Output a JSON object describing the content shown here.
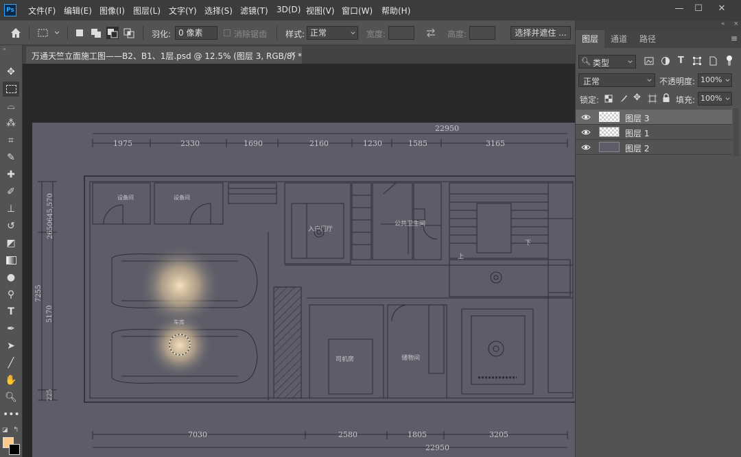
{
  "app": {
    "logo": "Ps",
    "menu": [
      "文件(F)",
      "编辑(E)",
      "图像(I)",
      "图层(L)",
      "文字(Y)",
      "选择(S)",
      "滤镜(T)",
      "3D(D)",
      "视图(V)",
      "窗口(W)",
      "帮助(H)"
    ],
    "window_controls": {
      "minimize": "—",
      "maximize": "☐",
      "close": "✕"
    }
  },
  "options": {
    "feather_label": "羽化:",
    "feather_value": "0 像素",
    "antialias_label": "消除锯齿",
    "style_label": "样式:",
    "style_value": "正常",
    "width_label": "宽度:",
    "height_label": "高度:",
    "select_mask_button": "选择并遮住 ..."
  },
  "document": {
    "tab_title": "万通天竺立面施工图——B2、B1、1层.psd @ 12.5% (图层 3, RGB/8) *",
    "close": "×"
  },
  "drawing": {
    "top_total": "22950",
    "top_dims": [
      "1975",
      "2330",
      "1690",
      "2160",
      "1230",
      "1585",
      "3165"
    ],
    "bottom_dims": [
      "7030",
      "2580",
      "1805",
      "3205"
    ],
    "bottom_total": "22950",
    "left_top": "2650645,570",
    "left_total": "7255",
    "left_mid": "5170",
    "left_bottom": "225",
    "rooms": [
      "设备间",
      "设备间",
      "入户门厅",
      "公共卫生间",
      "车库",
      "司机房",
      "储物间",
      "上",
      "下"
    ]
  },
  "panel": {
    "tabs": [
      "图层",
      "通道",
      "路径"
    ],
    "filter_kind": "类型",
    "blend_mode": "正常",
    "opacity_label": "不透明度:",
    "opacity_value": "100%",
    "lock_label": "锁定:",
    "fill_label": "填充:",
    "fill_value": "100%",
    "layers": [
      {
        "name": "图层 3",
        "selected": true
      },
      {
        "name": "图层 1",
        "selected": false
      },
      {
        "name": "图层 2",
        "selected": false
      }
    ]
  },
  "colors": {
    "foreground": "#fdca8c",
    "background": "#000000",
    "canvas": "#5d5d69"
  }
}
